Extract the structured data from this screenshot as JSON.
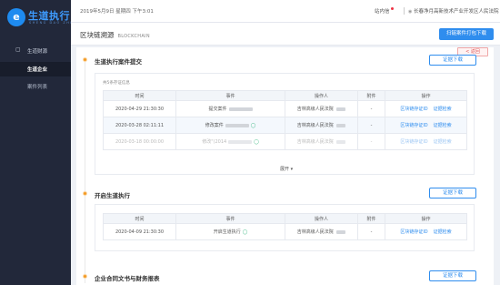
{
  "app": {
    "logo_text": "生道执行",
    "logo_sub": "SHENG DAO ZHI XING"
  },
  "sidebar": {
    "group": {
      "label": "生道财源",
      "icon": "folder-icon"
    },
    "items": [
      {
        "label": "生道企业",
        "active": true
      },
      {
        "label": "案件列表",
        "active": false
      }
    ]
  },
  "topbar": {
    "date": "2019年5月9日  星期四  下午3:01",
    "messages": "站内信",
    "user": "长春净月高新技术产业开发区人民法院"
  },
  "page": {
    "title": "区块链溯源",
    "title_en": "BLOCKCHAIN",
    "print_button": "扫链案件打包下载",
    "back_button": "< 返回"
  },
  "sections": [
    {
      "title": "生道执行案件提交",
      "download": "证据下载",
      "box_caption": "共5条存证信息",
      "expand": "展开",
      "columns": [
        "时间",
        "事件",
        "操作人",
        "附件",
        "操作"
      ],
      "rows": [
        {
          "time": "2020-04-29  21:30:30",
          "event": "提交案件",
          "operator": "吉林高级人民法院",
          "attachment": "-",
          "ops": [
            "区块链存证ID",
            "证据检索"
          ]
        },
        {
          "time": "2020-03-28  02:11:11",
          "event": "修改案件",
          "operator": "吉林高级人民法院",
          "attachment": "-",
          "ops": [
            "区块链存证ID",
            "证据检索"
          ]
        },
        {
          "time": "2020-03-18  00:00:00",
          "event": "修改\"(2014",
          "operator": "吉林高级人民法院",
          "attachment": "-",
          "ops": [
            "区块链存证ID",
            "证据检索"
          ]
        }
      ]
    },
    {
      "title": "开启生道执行",
      "download": "证据下载",
      "columns": [
        "时间",
        "事件",
        "操作人",
        "附件",
        "操作"
      ],
      "rows": [
        {
          "time": "2020-04-09  21:30:30",
          "event": "开启生道执行",
          "operator": "吉林高级人民法院",
          "attachment": "-",
          "ops": [
            "区块链存证ID",
            "证据检索"
          ]
        }
      ]
    },
    {
      "title": "企业合同文书与财务报表",
      "download": "证据下载"
    }
  ],
  "colors": {
    "accent": "#2f8dee",
    "sidebar": "#22283a",
    "marker": "#f39a24",
    "danger": "#e0595a"
  }
}
